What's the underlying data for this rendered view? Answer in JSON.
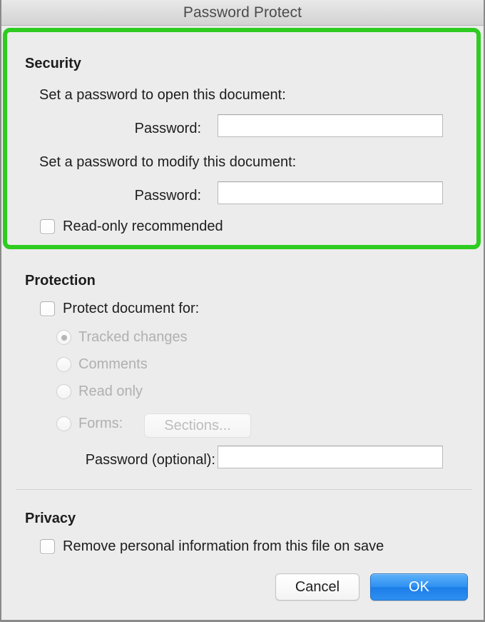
{
  "window": {
    "title": "Password Protect"
  },
  "security": {
    "heading": "Security",
    "open_prompt": "Set a password to open this document:",
    "open_password_label": "Password:",
    "open_password_value": "",
    "modify_prompt": "Set a password to modify this document:",
    "modify_password_label": "Password:",
    "modify_password_value": "",
    "read_only_label": "Read-only recommended",
    "read_only_checked": false
  },
  "protection": {
    "heading": "Protection",
    "protect_document_label": "Protect document for:",
    "protect_document_checked": false,
    "options": [
      {
        "label": "Tracked changes",
        "selected": true,
        "disabled": true
      },
      {
        "label": "Comments",
        "selected": false,
        "disabled": true
      },
      {
        "label": "Read only",
        "selected": false,
        "disabled": true
      },
      {
        "label": "Forms:",
        "selected": false,
        "disabled": true
      }
    ],
    "sections_button_label": "Sections...",
    "sections_button_disabled": true,
    "password_optional_label": "Password (optional):",
    "password_optional_value": ""
  },
  "privacy": {
    "heading": "Privacy",
    "remove_personal_info_label": "Remove personal information from this file on save",
    "remove_personal_info_checked": false
  },
  "buttons": {
    "cancel_label": "Cancel",
    "ok_label": "OK"
  },
  "annotation": {
    "highlight_color": "#2ecc20",
    "highlight_target": "security"
  },
  "colors": {
    "window_background": "#ececec",
    "titlebar_background": "#dcdcdc",
    "default_button": "#2f90f2",
    "text": "#1d1d1d",
    "disabled_text": "#b0b0b0"
  }
}
